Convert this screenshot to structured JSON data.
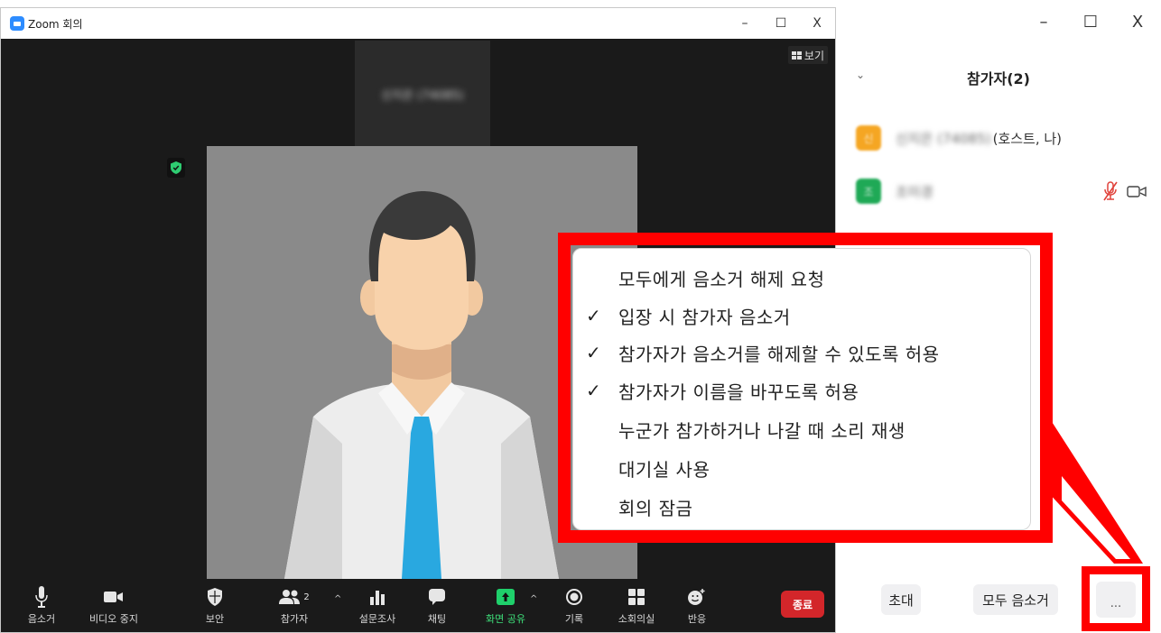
{
  "zoom_window": {
    "title": "Zoom 회의",
    "controls": {
      "minimize": "–",
      "maximize": "☐",
      "close": "X"
    },
    "view_label": "보기",
    "thumbnail_name": "신지은 (74085)",
    "main_video": {
      "description": "avatar"
    }
  },
  "toolbar": {
    "items": [
      {
        "label": "음소거"
      },
      {
        "label": "비디오 중지"
      },
      {
        "label": "보안"
      },
      {
        "label": "참가자",
        "count": "2"
      },
      {
        "label": "설문조사"
      },
      {
        "label": "채팅"
      },
      {
        "label": "화면 공유"
      },
      {
        "label": "기록"
      },
      {
        "label": "소회의실"
      },
      {
        "label": "반응"
      }
    ],
    "end_label": "종료"
  },
  "panel": {
    "controls": {
      "minimize": "–",
      "maximize": "☐",
      "close": "X"
    },
    "collapse_glyph": "⌄",
    "title": "참가자(2)",
    "participants": [
      {
        "name_blurred": "신지은 (74085)",
        "suffix": "(호스트, 나)",
        "avatar_color": "#f5a623",
        "avatar_letter": "신"
      },
      {
        "name_blurred": "조미경",
        "suffix": "",
        "avatar_color": "#1fa956",
        "avatar_letter": "조"
      }
    ],
    "footer": {
      "invite_label": "초대",
      "mute_all_label": "모두 음소거",
      "more_label": "..."
    }
  },
  "menu": {
    "items": [
      {
        "label": "모두에게 음소거 해제 요청",
        "checked": ""
      },
      {
        "label": "입장 시 참가자 음소거",
        "checked": "✓"
      },
      {
        "label": "참가자가 음소거를 해제할 수 있도록 허용",
        "checked": "✓"
      },
      {
        "label": "참가자가 이름을 바꾸도록 허용",
        "checked": "✓"
      },
      {
        "label": "누군가 참가하거나 나갈 때 소리 재생",
        "checked": ""
      },
      {
        "label": "대기실 사용",
        "checked": ""
      },
      {
        "label": "회의 잠금",
        "checked": ""
      }
    ]
  },
  "colors": {
    "highlight": "#ff0000",
    "zoom_blue": "#2d8cff",
    "end_red": "#d3262a",
    "share_green": "#3ee07a"
  }
}
